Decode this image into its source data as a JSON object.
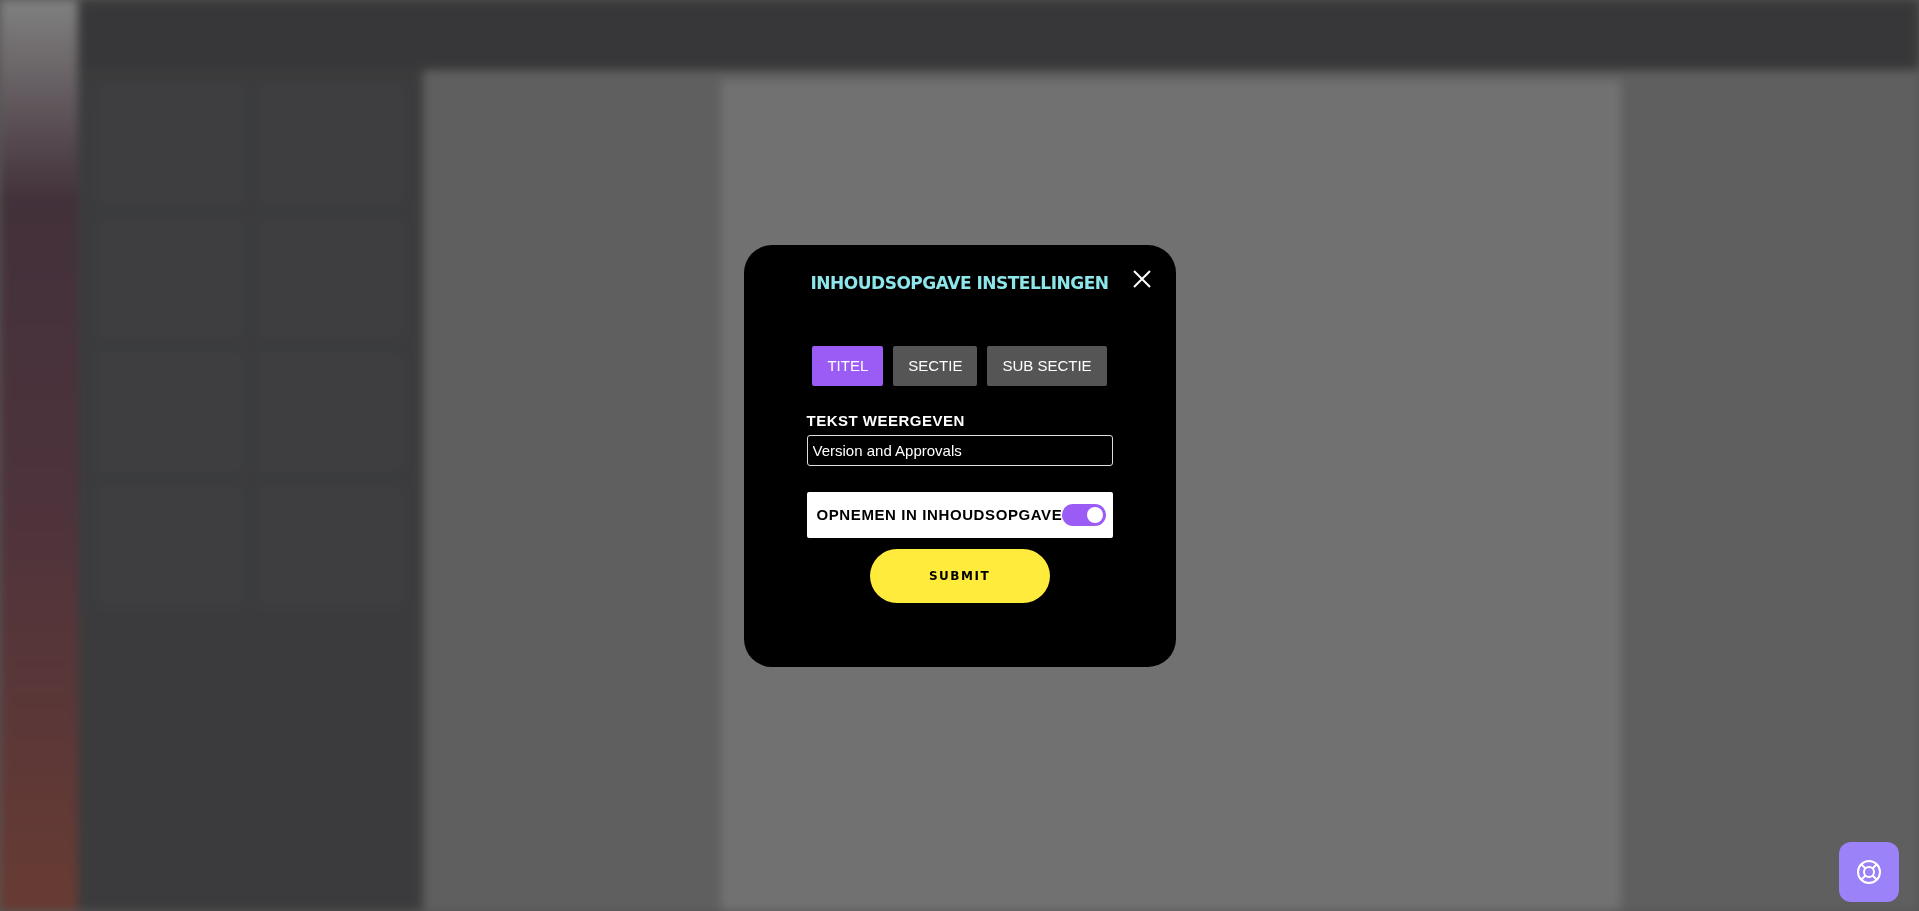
{
  "dialog": {
    "title": "INHOUDSOPGAVE INSTELLINGEN",
    "tabs": [
      {
        "label": "TITEL",
        "selected": true
      },
      {
        "label": "SECTIE",
        "selected": false
      },
      {
        "label": "SUB SECTIE",
        "selected": false
      }
    ],
    "field": {
      "label": "TEKST WEERGEVEN",
      "value": "Version and Approvals"
    },
    "toggle": {
      "label": "OPNEMEN IN INHOUDSOPGAVE",
      "on": true
    },
    "submit": "SUBMIT"
  }
}
